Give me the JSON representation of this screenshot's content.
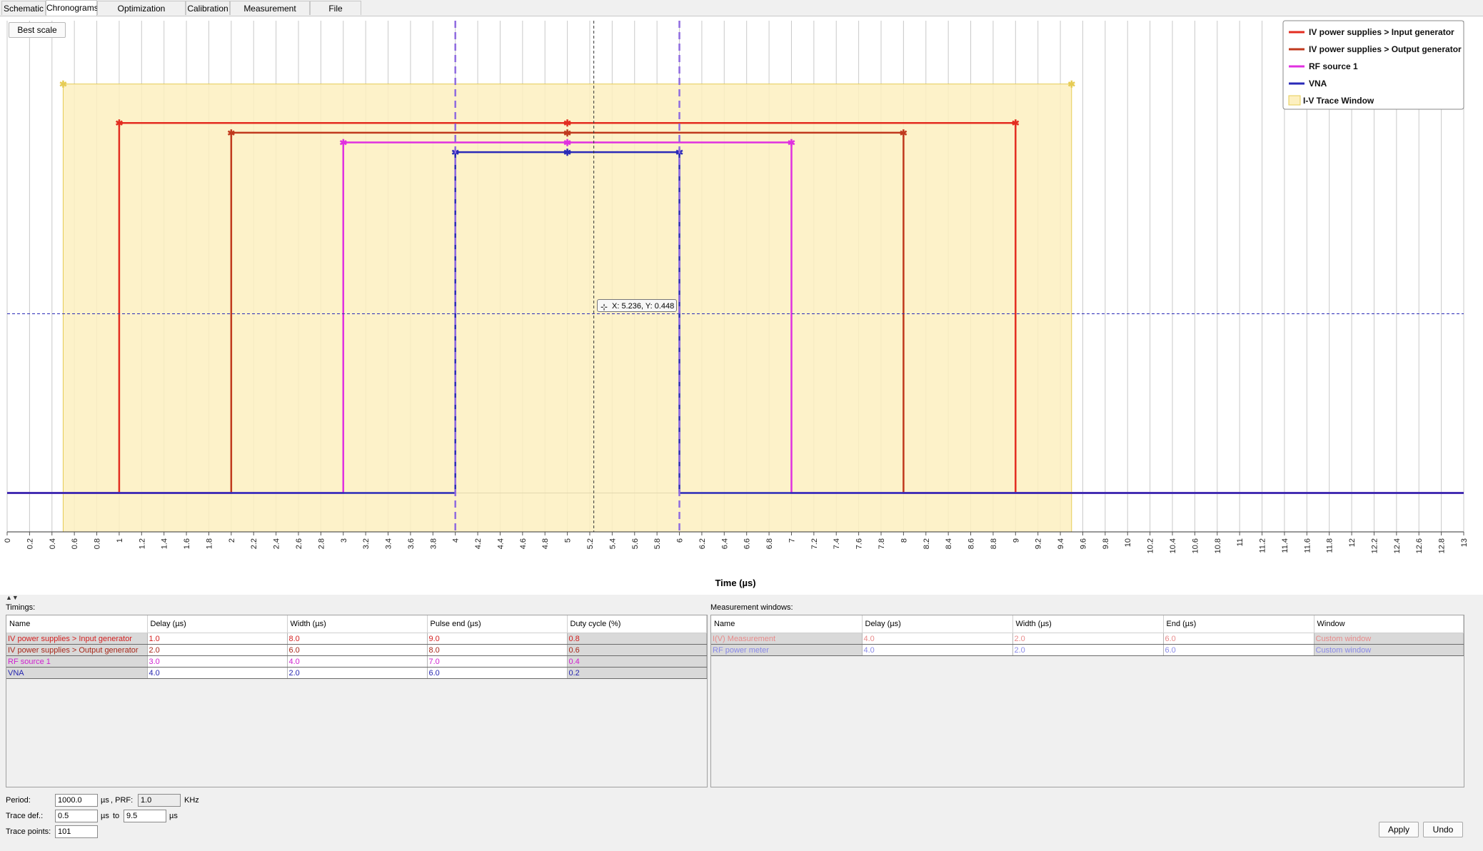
{
  "tabs": [
    {
      "label": "Schematic",
      "active": false
    },
    {
      "label": "Chronograms",
      "active": true
    },
    {
      "label": "Optimization strategies",
      "active": false
    },
    {
      "label": "Calibration",
      "active": false
    },
    {
      "label": "Measurement options",
      "active": false
    },
    {
      "label": "File manager",
      "active": false
    }
  ],
  "chart_toolbar": {
    "best_scale": "Best scale"
  },
  "chart_data": {
    "type": "line",
    "xlabel": "Time (µs)",
    "xlim": [
      0,
      13
    ],
    "x_ticks": [
      "0",
      "0.2",
      "0.4",
      "0.6",
      "0.8",
      "1",
      "1.2",
      "1.4",
      "1.6",
      "1.8",
      "2",
      "2.2",
      "2.4",
      "2.6",
      "2.8",
      "3",
      "3.2",
      "3.4",
      "3.6",
      "3.8",
      "4",
      "4.2",
      "4.4",
      "4.6",
      "4.8",
      "5",
      "5.2",
      "5.4",
      "5.6",
      "5.8",
      "6",
      "6.2",
      "6.4",
      "6.6",
      "6.8",
      "7",
      "7.2",
      "7.4",
      "7.6",
      "7.8",
      "8",
      "8.2",
      "8.4",
      "8.6",
      "8.8",
      "9",
      "9.2",
      "9.4",
      "9.6",
      "9.8",
      "10",
      "10.2",
      "10.4",
      "10.6",
      "10.8",
      "11",
      "11.2",
      "11.4",
      "11.6",
      "11.8",
      "12",
      "12.2",
      "12.4",
      "12.6",
      "12.8",
      "13"
    ],
    "ylim": [
      0,
      1.05
    ],
    "grid": "vertical",
    "legend_position": "top-right",
    "series": [
      {
        "name": "IV power supplies > Input generator",
        "color": "#e32d20",
        "start": 1.0,
        "end": 9.0,
        "level": 0.84
      },
      {
        "name": "IV power supplies > Output generator",
        "color": "#c0391d",
        "start": 2.0,
        "end": 8.0,
        "level": 0.82
      },
      {
        "name": "RF source 1",
        "color": "#e030e0",
        "start": 3.0,
        "end": 7.0,
        "level": 0.8
      },
      {
        "name": "VNA",
        "color": "#2a2ab8",
        "start": 4.0,
        "end": 6.0,
        "level": 0.78
      }
    ],
    "window": {
      "name": "I-V Trace Window",
      "start": 0.5,
      "end": 9.5,
      "fill": "#fdf0c0",
      "edge": "#e6cc55"
    },
    "cursor": {
      "x": 5.236,
      "y": 0.448,
      "label": "X: 5.236, Y: 0.448"
    },
    "markers_x": [
      4,
      6
    ],
    "marker_color": "#8f6be0"
  },
  "timings": {
    "label": "Timings:",
    "columns": [
      "Name",
      "Delay (µs)",
      "Width (µs)",
      "Pulse end (µs)",
      "Duty cycle (%)"
    ],
    "rows": [
      {
        "name": "IV power supplies > Input generator",
        "delay": "1.0",
        "width": "8.0",
        "end": "9.0",
        "duty": "0.8",
        "color": "#d42020"
      },
      {
        "name": "IV power supplies > Output generator",
        "delay": "2.0",
        "width": "6.0",
        "end": "8.0",
        "duty": "0.6",
        "color": "#a8281a"
      },
      {
        "name": "RF source 1",
        "delay": "3.0",
        "width": "4.0",
        "end": "7.0",
        "duty": "0.4",
        "color": "#d020d0"
      },
      {
        "name": "VNA",
        "delay": "4.0",
        "width": "2.0",
        "end": "6.0",
        "duty": "0.2",
        "color": "#2525b0"
      }
    ]
  },
  "measurement_windows": {
    "label": "Measurement windows:",
    "columns": [
      "Name",
      "Delay (µs)",
      "Width (µs)",
      "End (µs)",
      "Window"
    ],
    "rows": [
      {
        "name": "I(V) Measurement",
        "delay": "4.0",
        "width": "2.0",
        "end": "6.0",
        "window": "Custom window",
        "color": "#e88a8a"
      },
      {
        "name": "RF power meter",
        "delay": "4.0",
        "width": "2.0",
        "end": "6.0",
        "window": "Custom window",
        "color": "#8a8ae8"
      }
    ]
  },
  "settings": {
    "period_label": "Period:",
    "period_value": "1000.0",
    "period_unit": "µs",
    "prf_label": ", PRF:",
    "prf_value": "1.0",
    "prf_unit": "KHz",
    "trace_def_label": "Trace def.:",
    "trace_from": "0.5",
    "trace_from_unit": "µs",
    "to_label": "to",
    "trace_to": "9.5",
    "trace_to_unit": "µs",
    "trace_points_label": "Trace points:",
    "trace_points": "101"
  },
  "actions": {
    "apply": "Apply",
    "undo": "Undo"
  }
}
